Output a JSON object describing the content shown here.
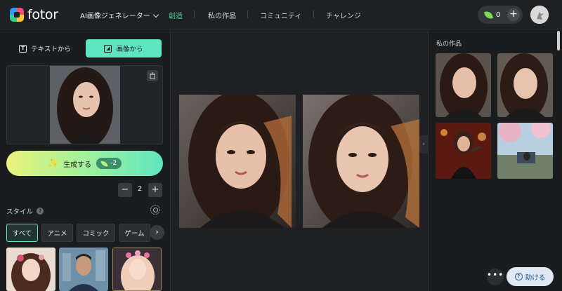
{
  "header": {
    "logo_text": "fotor",
    "nav": {
      "generator": "AI画像ジェネレーター",
      "create": "創造",
      "my_works": "私の作品",
      "community": "コミュニティ",
      "challenge": "チャレンジ"
    },
    "credits": "0",
    "plus": "+"
  },
  "left_panel": {
    "tabs": [
      {
        "label": "テキストから",
        "icon": "text-icon"
      },
      {
        "label": "画像から",
        "icon": "image-icon",
        "active": true
      }
    ],
    "upload": {
      "delete_icon": "trash-icon"
    },
    "generate": {
      "label": "生成する",
      "cost": "-2",
      "icon": "magic-wand-icon"
    },
    "quantity": {
      "minus": "−",
      "value": "2",
      "plus": "+"
    },
    "style": {
      "label": "スタイル",
      "help": "?",
      "settings_icon": "gear-icon"
    },
    "style_chips": [
      {
        "label": "すべて",
        "active": true
      },
      {
        "label": "アニメ"
      },
      {
        "label": "コミック"
      },
      {
        "label": "ゲーム"
      }
    ],
    "next_arrow": "›"
  },
  "center": {
    "results": [
      "generated-portrait-1",
      "generated-portrait-2"
    ],
    "collapse_arrow": "›"
  },
  "right_panel": {
    "title": "私の作品",
    "more": "•••",
    "help_label": "助ける"
  },
  "colors": {
    "accent": "#5fe6c0",
    "nav_active": "#3fd69b",
    "background": "#1b1c1e"
  }
}
